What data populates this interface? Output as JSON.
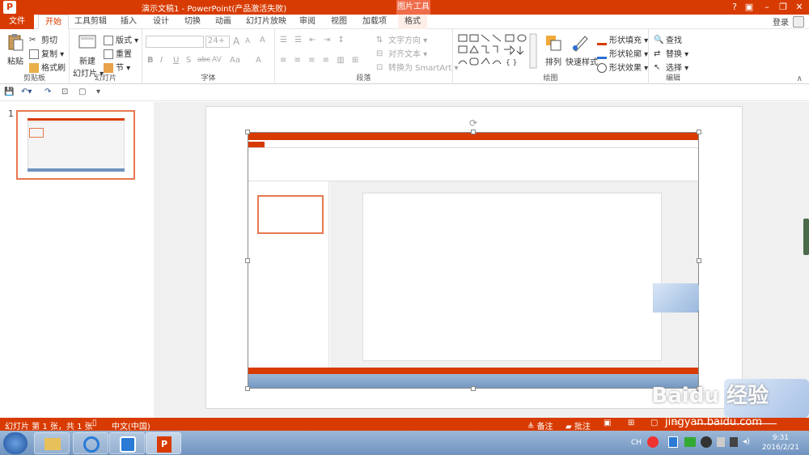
{
  "titlebar": {
    "logo": "P",
    "title": "演示文稿1 -  PowerPoint(产品激活失败)",
    "context_tab": "图片工具",
    "help": "?",
    "restore_ribbon": "▣",
    "min": "–",
    "max": "❐",
    "close": "✕"
  },
  "tabs": {
    "file": "文件",
    "home": "开始",
    "tool1": "工具剪辑",
    "insert": "插入",
    "design": "设计",
    "transitions": "切换",
    "animations": "动画",
    "slideshow": "幻灯片放映",
    "review": "审阅",
    "view": "视图",
    "addins": "加载项",
    "format": "格式",
    "login": "登录"
  },
  "ribbon": {
    "clipboard": {
      "label": "剪贴板",
      "paste": "粘贴",
      "cut": "剪切",
      "copy": "复制 ▾",
      "painter": "格式刷"
    },
    "slides": {
      "label": "幻灯片",
      "new_slide": "新建",
      "new_slide2": "幻灯片 ▾",
      "layout": "版式 ▾",
      "reset": "重置",
      "section": "节 ▾"
    },
    "font": {
      "label": "字体",
      "size": "24+",
      "grow": "A",
      "shrink": "A",
      "clear": "A",
      "bold": "B",
      "italic": "I",
      "underline": "U",
      "shadow": "S",
      "strike": "abc",
      "spacing": "AV",
      "case": "Aa",
      "color": "A"
    },
    "paragraph": {
      "label": "段落",
      "text_dir": "文字方向 ▾",
      "align_text": "对齐文本 ▾",
      "smartart": "转换为 SmartArt ▾"
    },
    "drawing": {
      "label": "绘图",
      "arrange": "排列",
      "quick_styles": "快速样式",
      "fill": "形状填充 ▾",
      "outline": "形状轮廓 ▾",
      "effects": "形状效果 ▾"
    },
    "editing": {
      "label": "编辑",
      "find": "查找",
      "replace": "替换 ▾",
      "select": "选择 ▾"
    }
  },
  "slide_panel": {
    "number": "1"
  },
  "statusbar": {
    "slide_info": "幻灯片 第 1 张，共 1 张",
    "language": "中文(中国)",
    "notes": "备注",
    "comments": "批注"
  },
  "taskbar": {
    "ime": "CH",
    "time": "9:31",
    "date": "2016/2/21"
  },
  "watermark": {
    "brand": "Baidu 经验",
    "url": "jingyan.baidu.com"
  },
  "colors": {
    "accent": "#d83b01",
    "slide_thumb_border": "#e6784f"
  }
}
